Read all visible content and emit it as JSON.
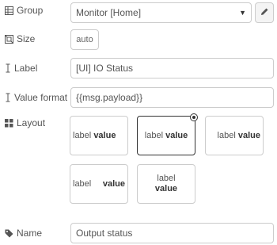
{
  "group": {
    "label": "Group",
    "value": "Monitor [Home]",
    "icon": "table-icon"
  },
  "size": {
    "label": "Size",
    "value": "auto",
    "icon": "resize-icon"
  },
  "label_field": {
    "label": "Label",
    "value": "[UI] IO Status",
    "icon": "text-cursor-icon"
  },
  "value_format": {
    "label": "Value format",
    "value": "{{msg.payload}}",
    "icon": "text-cursor-icon"
  },
  "layout": {
    "label": "Layout",
    "icon": "grid-icon",
    "options": [
      {
        "label_text": "label",
        "value_text": "value",
        "style": "row-left"
      },
      {
        "label_text": "label",
        "value_text": "value",
        "style": "row-center",
        "selected": true
      },
      {
        "label_text": "label",
        "value_text": "value",
        "style": "row-right"
      },
      {
        "label_text": "label",
        "value_text": "value",
        "style": "row-spread"
      },
      {
        "label_text": "label",
        "value_text": "value",
        "style": "col-center"
      }
    ]
  },
  "name": {
    "label": "Name",
    "value": "Output status",
    "icon": "tag-icon"
  }
}
